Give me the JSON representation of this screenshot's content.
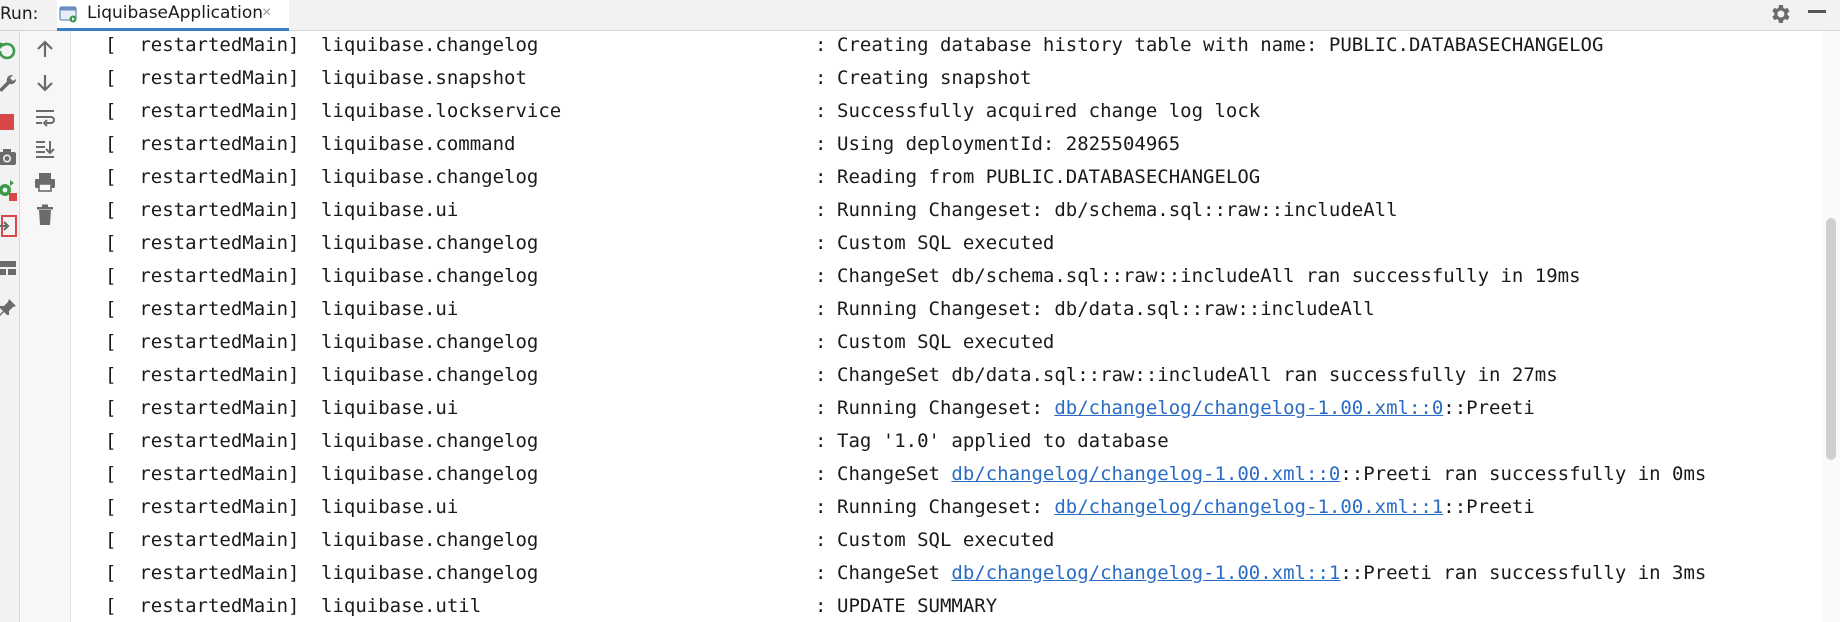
{
  "topbar": {
    "run_label": "Run:",
    "tab_label": "LiquibaseApplication",
    "tab_close": "×"
  },
  "toolbar": {
    "outer_icons": [
      "rerun-icon",
      "wrench-icon",
      "stop-icon",
      "camera-icon",
      "restore-layout-icon",
      "login-icon",
      "layout-icon",
      "pin-icon"
    ],
    "inner_icons": [
      "arrow-up-icon",
      "arrow-down-icon",
      "soft-wrap-icon",
      "scroll-to-end-icon",
      "print-icon",
      "trash-icon"
    ]
  },
  "colors": {
    "tab_underline": "#3d7bc9",
    "link": "#2b6cc4",
    "rerun_green": "#3d9a4b",
    "stop_red": "#d94848"
  },
  "console": {
    "lines": [
      {
        "prefix": "[  restartedMain]",
        "logger": "liquibase.changelog",
        "colon": ":",
        "pre": "Creating database history table with name: PUBLIC.DATABASECHANGELOG",
        "link": "",
        "post": ""
      },
      {
        "prefix": "[  restartedMain]",
        "logger": "liquibase.snapshot",
        "colon": ":",
        "pre": "Creating snapshot",
        "link": "",
        "post": ""
      },
      {
        "prefix": "[  restartedMain]",
        "logger": "liquibase.lockservice",
        "colon": ":",
        "pre": "Successfully acquired change log lock",
        "link": "",
        "post": ""
      },
      {
        "prefix": "[  restartedMain]",
        "logger": "liquibase.command",
        "colon": ":",
        "pre": "Using deploymentId: 2825504965",
        "link": "",
        "post": ""
      },
      {
        "prefix": "[  restartedMain]",
        "logger": "liquibase.changelog",
        "colon": ":",
        "pre": "Reading from PUBLIC.DATABASECHANGELOG",
        "link": "",
        "post": ""
      },
      {
        "prefix": "[  restartedMain]",
        "logger": "liquibase.ui",
        "colon": ":",
        "pre": "Running Changeset: db/schema.sql::raw::includeAll",
        "link": "",
        "post": ""
      },
      {
        "prefix": "[  restartedMain]",
        "logger": "liquibase.changelog",
        "colon": ":",
        "pre": "Custom SQL executed",
        "link": "",
        "post": ""
      },
      {
        "prefix": "[  restartedMain]",
        "logger": "liquibase.changelog",
        "colon": ":",
        "pre": "ChangeSet db/schema.sql::raw::includeAll ran successfully in 19ms",
        "link": "",
        "post": ""
      },
      {
        "prefix": "[  restartedMain]",
        "logger": "liquibase.ui",
        "colon": ":",
        "pre": "Running Changeset: db/data.sql::raw::includeAll",
        "link": "",
        "post": ""
      },
      {
        "prefix": "[  restartedMain]",
        "logger": "liquibase.changelog",
        "colon": ":",
        "pre": "Custom SQL executed",
        "link": "",
        "post": ""
      },
      {
        "prefix": "[  restartedMain]",
        "logger": "liquibase.changelog",
        "colon": ":",
        "pre": "ChangeSet db/data.sql::raw::includeAll ran successfully in 27ms",
        "link": "",
        "post": ""
      },
      {
        "prefix": "[  restartedMain]",
        "logger": "liquibase.ui",
        "colon": ":",
        "pre": "Running Changeset: ",
        "link": "db/changelog/changelog-1.00.xml::0",
        "post": "::Preeti"
      },
      {
        "prefix": "[  restartedMain]",
        "logger": "liquibase.changelog",
        "colon": ":",
        "pre": "Tag '1.0' applied to database",
        "link": "",
        "post": ""
      },
      {
        "prefix": "[  restartedMain]",
        "logger": "liquibase.changelog",
        "colon": ":",
        "pre": "ChangeSet ",
        "link": "db/changelog/changelog-1.00.xml::0",
        "post": "::Preeti ran successfully in 0ms"
      },
      {
        "prefix": "[  restartedMain]",
        "logger": "liquibase.ui",
        "colon": ":",
        "pre": "Running Changeset: ",
        "link": "db/changelog/changelog-1.00.xml::1",
        "post": "::Preeti"
      },
      {
        "prefix": "[  restartedMain]",
        "logger": "liquibase.changelog",
        "colon": ":",
        "pre": "Custom SQL executed",
        "link": "",
        "post": ""
      },
      {
        "prefix": "[  restartedMain]",
        "logger": "liquibase.changelog",
        "colon": ":",
        "pre": "ChangeSet ",
        "link": "db/changelog/changelog-1.00.xml::1",
        "post": "::Preeti ran successfully in 3ms"
      },
      {
        "prefix": "[  restartedMain]",
        "logger": "liquibase.util",
        "colon": ":",
        "pre": "UPDATE SUMMARY",
        "link": "",
        "post": ""
      }
    ]
  }
}
